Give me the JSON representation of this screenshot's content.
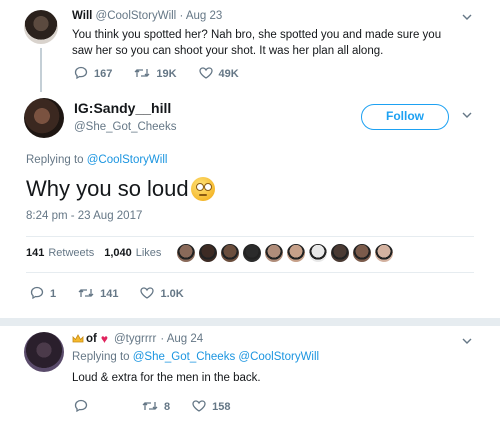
{
  "parent_tweet": {
    "display_name": "Will",
    "handle": "@CoolStoryWill",
    "date": "· Aug 23",
    "text": "You think you spotted her? Nah bro, she spotted you and made sure you saw her so you can shoot your shot. It was her plan all along.",
    "replies": "167",
    "retweets": "19K",
    "likes": "49K"
  },
  "main_tweet": {
    "display_name": "IG:Sandy__hill",
    "handle": "@She_Got_Cheeks",
    "follow_label": "Follow",
    "replying_prefix": "Replying to",
    "replying_handle": "@CoolStoryWill",
    "text": "Why you so loud",
    "emoji": "face-with-rolling-eyes",
    "timestamp": "8:24 pm - 23 Aug 2017",
    "retweet_count": "141",
    "retweet_label": "Retweets",
    "like_count": "1,040",
    "like_label": "Likes",
    "liker_colors": [
      "#8a6a5a",
      "#3d2b24",
      "#6b4e3d",
      "#2b2b2b",
      "#b08d7a",
      "#c7a18a",
      "#e8e8e8",
      "#4a3a33",
      "#7b5b4b",
      "#d4b2a0"
    ],
    "replies": "1",
    "retweets": "141",
    "likes": "1.0K"
  },
  "reply_tweet": {
    "display_name": "of",
    "handle": "@tygrrrr",
    "date": "· Aug 24",
    "replying_prefix": "Replying to",
    "replying_handles": "@She_Got_Cheeks @CoolStoryWill",
    "text": "Loud & extra for the men in the back.",
    "replies": "",
    "retweets": "8",
    "likes": "158"
  },
  "colors": {
    "accent": "#1da1f2",
    "link": "#1b95e0",
    "muted": "#657786",
    "divider": "#e6ecf0",
    "heart": "#e0245e"
  }
}
